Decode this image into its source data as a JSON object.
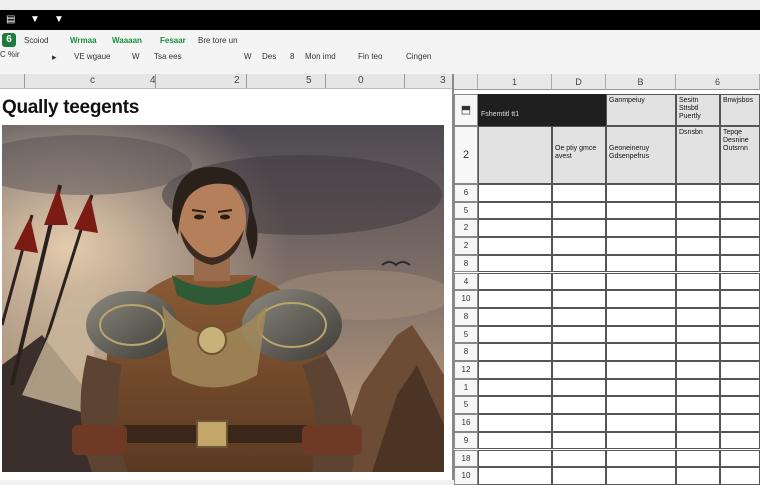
{
  "colors": {
    "title_bar": "#000000",
    "brand_green": "#1e7b3e",
    "header_dark": "#1f1f1f"
  },
  "titlebar": {
    "icons": [
      "menu-icon",
      "dropdown-icon",
      "dropdown-icon"
    ]
  },
  "ribbon": {
    "row1": [
      {
        "label": "Scoiod",
        "tone": "dark"
      },
      {
        "label": "Wrmaa",
        "tone": "green"
      },
      {
        "label": "Waaaan",
        "tone": "green"
      },
      {
        "label": "Fesaar",
        "tone": "green"
      },
      {
        "label": "Bre tore un",
        "tone": "dark"
      }
    ],
    "row2_left": "C %ir",
    "row2_mark": "▸",
    "row2": [
      "VE wgaue",
      "W",
      "Tsa ees",
      "W",
      "Des",
      "8",
      "Mon imd",
      "Fin teo",
      "Cingen"
    ]
  },
  "ruler": {
    "numbers": [
      "c",
      "4",
      "2",
      "5",
      "0",
      "3"
    ]
  },
  "document": {
    "title": "Qually teegents"
  },
  "sheet": {
    "column_letters": [
      "1",
      "D",
      "B",
      "6"
    ],
    "header_row": {
      "dark_cell": "Fshemtitl tt1",
      "cells": [
        "Ganmpeiuy",
        "Sesitn Sttsbtl Puertly",
        "Bnwjsbos"
      ]
    },
    "second_row": {
      "row_label": "2",
      "cells": [
        "",
        "Oe ptiy gmce avest",
        "Geoneineruy Gdsenpefrus",
        "Dsnsbn",
        "Tepqe Desnine Outsrnn"
      ]
    },
    "row_numbers": [
      "6",
      "5",
      "2",
      "2",
      "8",
      "4",
      "10",
      "8",
      "5",
      "8",
      "12",
      "1",
      "5",
      "16",
      "9",
      "18",
      "10"
    ]
  }
}
